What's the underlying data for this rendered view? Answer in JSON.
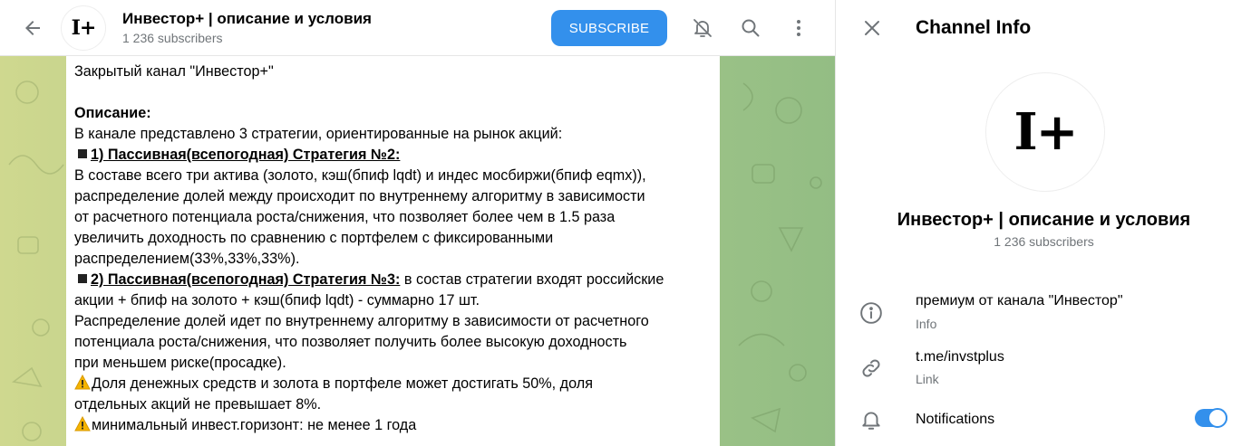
{
  "header": {
    "channel_title": "Инвестор+ | описание и условия",
    "subscribers": "1 236 subscribers",
    "subscribe_label": "SUBSCRIBE",
    "avatar_text": "I+"
  },
  "message": {
    "lines": [
      "Закрытый канал \"Инвестор+\"",
      "",
      "Описание:",
      "В канале представлено 3 стратегии, ориентированные на рынок акций:",
      "1) Пассивная(всепогодная) Стратегия №2:",
      "В составе всего три актива (золото, кэш(бпиф lqdt) и индес мосбиржи(бпиф eqmx)),",
      "распределение долей между происходит по внутреннему алгоритму в зависимости",
      "от расчетного потенциала роста/снижения, что позволяет более чем в 1.5 раза",
      "увеличить доходность по сравнению с портфелем с фиксированными",
      "распределением(33%,33%,33%).",
      "2) Пассивная(всепогодная) Стратегия №3:",
      " в состав стратегии входят российские",
      "акции + бпиф на золото + кэш(бпиф lqdt) - суммарно 17 шт.",
      "Распределение долей идет по внутреннему алгоритму в зависимости от расчетного",
      "потенциала роста/снижения, что позволяет получить более высокую доходность",
      "при меньшем риске(просадке).",
      "Доля денежных средств и золота в портфеле может достигать 50%, доля",
      "отдельных акций не превышает 8%.",
      "минимальный инвест.горизонт: не менее 1 года"
    ]
  },
  "info": {
    "title": "Channel Info",
    "avatar_text": "I+",
    "name": "Инвестор+ | описание и условия",
    "subscribers": "1 236 subscribers",
    "description": "премиум от канала \"Инвестор\"",
    "description_label": "Info",
    "link": "t.me/invstplus",
    "link_label": "Link",
    "notifications_label": "Notifications",
    "notifications_on": true
  },
  "colors": {
    "accent": "#3390ec",
    "secondary_text": "#707579",
    "warning": "#f5b400"
  },
  "icons": [
    "back-arrow-icon",
    "bell-off-icon",
    "search-icon",
    "more-vertical-icon",
    "close-icon",
    "info-icon",
    "link-icon",
    "bell-icon",
    "warning-icon",
    "square-bullet-icon"
  ]
}
